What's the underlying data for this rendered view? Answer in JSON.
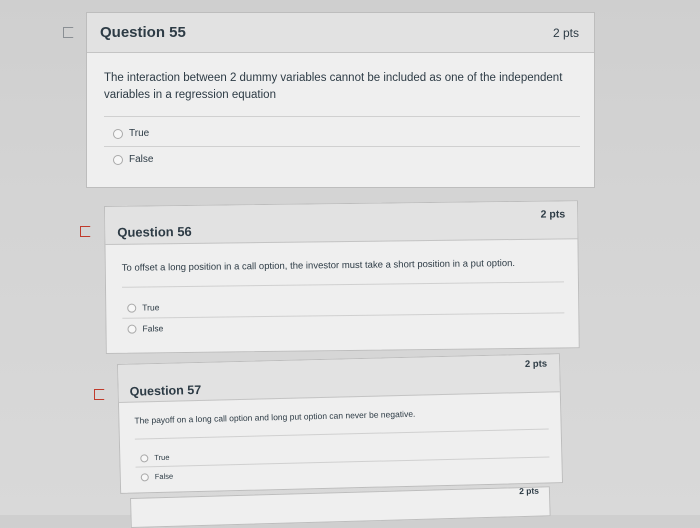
{
  "questions": [
    {
      "title": "Question 55",
      "points": "2 pts",
      "text": "The interaction between 2 dummy variables cannot be included as one of the independent variables in a regression equation",
      "options": [
        "True",
        "False"
      ],
      "flagged": false
    },
    {
      "title": "Question 56",
      "points": "2 pts",
      "text": "To offset a long position in a call option, the investor must take a short position in a put option.",
      "options": [
        "True",
        "False"
      ],
      "flagged": true
    },
    {
      "title": "Question 57",
      "points": "2 pts",
      "text": "The payoff on a long call option and long put option can never be negative.",
      "options": [
        "True",
        "False"
      ],
      "flagged": true
    }
  ],
  "next_question": {
    "points": "2 pts"
  }
}
